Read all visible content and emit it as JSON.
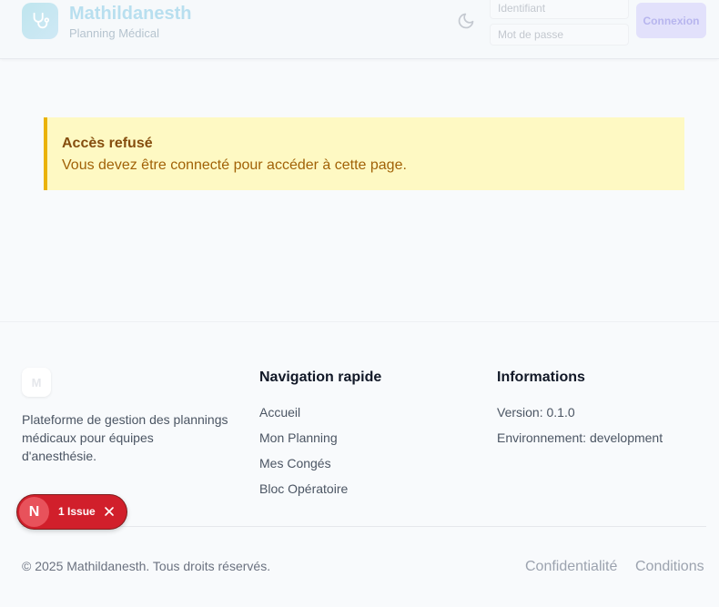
{
  "header": {
    "brand_title": "Mathildanesth",
    "brand_subtitle": "Planning Médical",
    "logo_icon": "stethoscope-icon",
    "theme_toggle_icon": "moon-icon",
    "username_placeholder": "Identifiant",
    "password_placeholder": "Mot de passe",
    "login_button": "Connexion"
  },
  "alert": {
    "title": "Accès refusé",
    "message": "Vous devez être connecté pour accéder à cette page."
  },
  "footer": {
    "logo_letter": "M",
    "description": "Plateforme de gestion des plannings médicaux pour équipes d'anesthésie.",
    "navigation": {
      "title": "Navigation rapide",
      "links": [
        "Accueil",
        "Mon Planning",
        "Mes Congés",
        "Bloc Opératoire"
      ]
    },
    "info": {
      "title": "Informations",
      "version": "Version: 0.1.0",
      "environment": "Environnement: development"
    },
    "copyright": "© 2025 Mathildanesth. Tous droits réservés.",
    "privacy_link": "Confidentialité",
    "terms_link": "Conditions"
  },
  "issue_badge": {
    "letter": "N",
    "label": "1 Issue",
    "close_icon": "close-icon"
  },
  "colors": {
    "alert_background": "#fef9c3",
    "alert_border": "#eab308",
    "issue_badge": "#d11f2b",
    "login_button": "#e2e1fb"
  }
}
